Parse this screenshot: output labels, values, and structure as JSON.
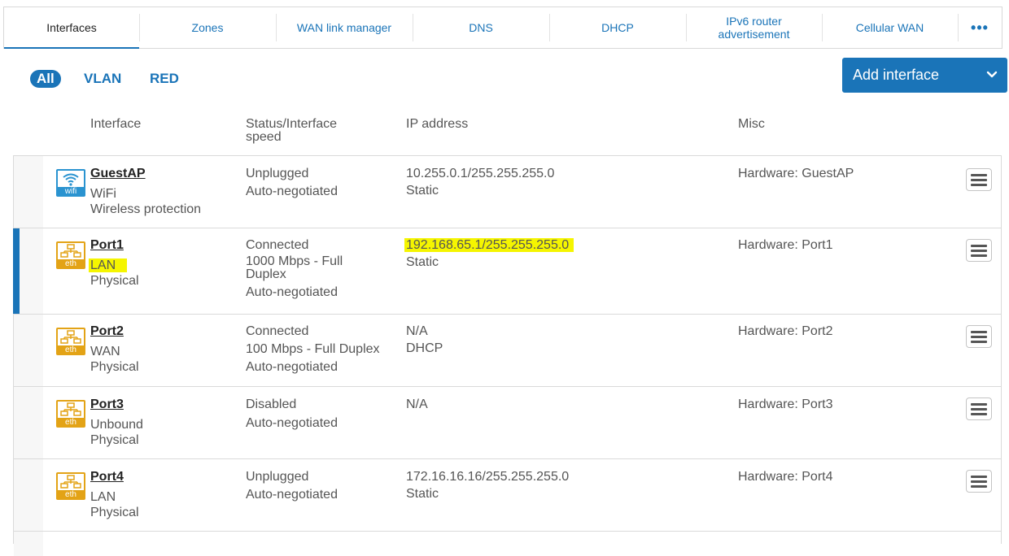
{
  "tabs": [
    {
      "label": "Interfaces",
      "active": true
    },
    {
      "label": "Zones"
    },
    {
      "label": "WAN link manager"
    },
    {
      "label": "DNS"
    },
    {
      "label": "DHCP"
    },
    {
      "label": "IPv6 router advertisement"
    },
    {
      "label": "Cellular WAN"
    }
  ],
  "tabs_more": "•••",
  "filters": {
    "all": "All",
    "vlan": "VLAN",
    "red": "RED"
  },
  "add_interface": "Add interface",
  "columns": {
    "interface": "Interface",
    "status": "Status/Interface speed",
    "ip": "IP address",
    "misc": "Misc"
  },
  "colors": {
    "accent": "#1a74b8",
    "wifi_icon": "#2a93d0",
    "eth_icon": "#e3a316",
    "highlight": "#f5f500"
  },
  "rows": [
    {
      "icon": "wifi-icon",
      "icon_label": "wifi",
      "name": "GuestAP",
      "zone": "WiFi",
      "type": "Wireless protection",
      "status": "Unplugged",
      "speed": "Auto-negotiated",
      "speed2": "",
      "ip": "10.255.0.1/255.255.255.0",
      "ip_mode": "Static",
      "misc": "Hardware:  GuestAP"
    },
    {
      "icon": "ethernet-icon",
      "icon_label": "eth",
      "name": "Port1",
      "zone": "LAN",
      "type": "Physical",
      "status": "Connected",
      "speed": "1000 Mbps - Full Duplex",
      "speed2": "Auto-negotiated",
      "ip": "192.168.65.1/255.255.255.0",
      "ip_mode": "Static",
      "misc": "Hardware:  Port1",
      "selected": true
    },
    {
      "icon": "ethernet-icon",
      "icon_label": "eth",
      "name": "Port2",
      "zone": "WAN",
      "type": "Physical",
      "status": "Connected",
      "speed": "100 Mbps - Full Duplex",
      "speed2": "Auto-negotiated",
      "ip": "N/A",
      "ip_mode": "DHCP",
      "misc": "Hardware:  Port2"
    },
    {
      "icon": "ethernet-icon",
      "icon_label": "eth",
      "name": "Port3",
      "zone": "Unbound",
      "type": "Physical",
      "status": "Disabled",
      "speed": "Auto-negotiated",
      "speed2": "",
      "ip": "N/A",
      "ip_mode": "",
      "misc": "Hardware:  Port3"
    },
    {
      "icon": "ethernet-icon",
      "icon_label": "eth",
      "name": "Port4",
      "zone": "LAN",
      "type": "Physical",
      "status": "Unplugged",
      "speed": "Auto-negotiated",
      "speed2": "",
      "ip": "172.16.16.16/255.255.255.0",
      "ip_mode": "Static",
      "misc": "Hardware:  Port4"
    }
  ]
}
